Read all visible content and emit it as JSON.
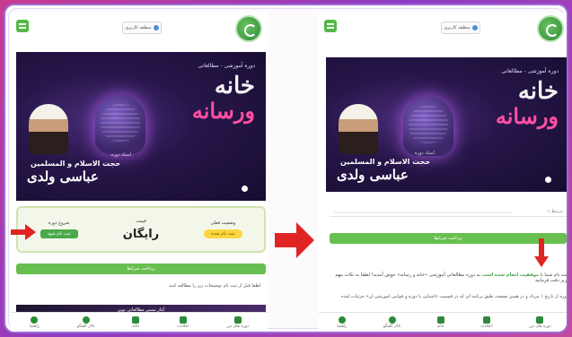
{
  "left_phone": {
    "user_chip": "منطقه کاربری",
    "banner": {
      "course_tag": "دوره آموزشی - مطالعاتی",
      "title_line1": "خانه",
      "title_line2": "ورسانه",
      "teacher_label": "استاد دوره",
      "teacher_title": "حجت الاسلام و المسلمین",
      "teacher_name": "عباسی ولدی"
    },
    "info": {
      "status_label": "وضعیت فعلی",
      "status_value": "ثبت نام شده",
      "price_label": "قیمت",
      "price_value": "رایگان",
      "start_label": "شروع دوره",
      "start_button": "ثبت نام شود"
    },
    "green_bar": "پرداخت شرایط",
    "text_line": "لطفا قبل از ثبت نام توضیحات زیر را مطالعه کنید",
    "dark_strip": "آغاز مسیر مطالعاتی نوین"
  },
  "right_phone": {
    "user_chip": "منطقه کاربری",
    "banner": {
      "course_tag": "دوره آموزشی - مطالعاتی",
      "title_line1": "خانه",
      "title_line2": "ورسانه",
      "teacher_label": "استاد دوره",
      "teacher_title": "حجت الاسلام و المسلمین",
      "teacher_name": "عباسی ولدی"
    },
    "progress_label": "۰٪ مرتبط",
    "green_bar": "پرداخت شرایط",
    "success_pre": "ثبت نام شما با ",
    "success_highlight": "موفقیت انجام شده است",
    "success_post": " به دوره مطالعاتی آموزشی «خانه و رسانه» خوش آمدید! لطفا به نکات مهم زیر دقت فرمایید:",
    "info_line": "دوره از تاریخ ۱ مرداد و در همین صفحه، طبق برنامه ای که در قسمت «آشنایی با دوره و قوانین آموزشی آن» جزئیات آمده"
  },
  "bottom_nav": [
    {
      "label": "دوره های من",
      "icon": "folder-icon"
    },
    {
      "label": "اعلانات",
      "icon": "bell-icon"
    },
    {
      "label": "خانه",
      "icon": "home-icon"
    },
    {
      "label": "تالار گفتگو",
      "icon": "users-icon"
    },
    {
      "label": "راهنما",
      "icon": "help-icon"
    }
  ],
  "colors": {
    "background_gradient_start": "#c93a8f",
    "background_gradient_end": "#8e3cc4",
    "frame_border": "#9c6ad6",
    "green": "#67bf4f",
    "arrow_red": "#e02424",
    "banner_dark": "#170c30",
    "title_pink": "#ff4fa3"
  }
}
